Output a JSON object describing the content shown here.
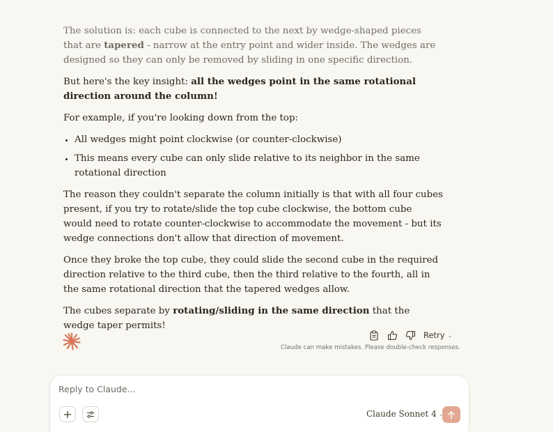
{
  "message": {
    "p1": {
      "pre": "The solution is: each cube is connected to the next by wedge-shaped pieces that are ",
      "bold": "tapered",
      "post": " - narrow at the entry point and wider inside. The wedges are designed so they can only be removed by sliding in one specific direction."
    },
    "p2": {
      "pre": "But here's the key insight: ",
      "bold": "all the wedges point in the same rotational direction around the column!"
    },
    "p3": "For example, if you're looking down from the top:",
    "bullets": [
      "All wedges might point clockwise (or counter-clockwise)",
      "This means every cube can only slide relative to its neighbor in the same rotational direction"
    ],
    "p4": "The reason they couldn't separate the column initially is that with all four cubes present, if you try to rotate/slide the top cube clockwise, the bottom cube would need to rotate counter-clockwise to accommodate the movement - but its wedge connections don't allow that direction of movement.",
    "p5": "Once they broke the top cube, they could slide the second cube in the required direction relative to the third cube, then the third relative to the fourth, all in the same rotational direction that the tapered wedges allow.",
    "p6": {
      "pre": "The cubes separate by ",
      "bold": "rotating/sliding in the same direction",
      "post": " that the wedge taper permits!"
    }
  },
  "actions": {
    "copy_icon": "clipboard-icon",
    "thumbs_up_icon": "thumbs-up-icon",
    "thumbs_down_icon": "thumbs-down-icon",
    "retry_label": "Retry",
    "disclaimer": "Claude can make mistakes. Please double-check responses."
  },
  "composer": {
    "placeholder": "Reply to Claude...",
    "model_label": "Claude Sonnet 4",
    "add_icon": "plus-icon",
    "tools_icon": "sliders-icon",
    "send_icon": "arrow-up-icon"
  },
  "colors": {
    "background": "#f8f7f2",
    "text": "#29261b",
    "accent": "#d97757",
    "send_button": "#e1a792"
  }
}
